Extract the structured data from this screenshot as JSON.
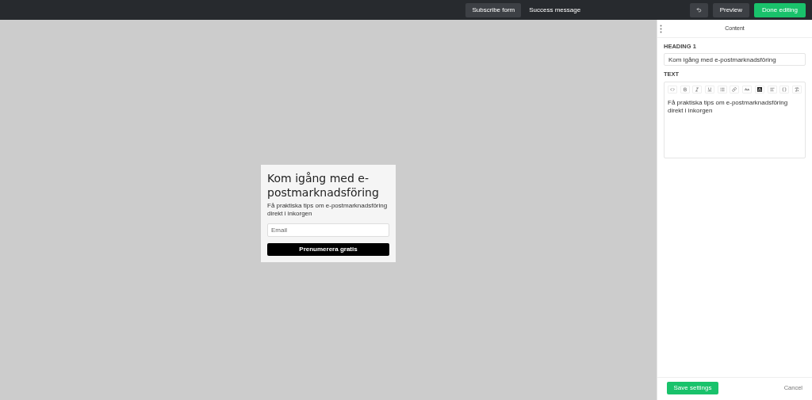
{
  "tabs": [
    {
      "label": "Subscribe form",
      "selected": true
    },
    {
      "label": "Success message",
      "selected": false
    }
  ],
  "actions": {
    "preview": "Preview",
    "done": "Done editing"
  },
  "form": {
    "heading": "Kom igång med e-postmarknadsföring",
    "text": "Få praktiska tips om e-postmarknadsföring direkt i inkorgen",
    "email_placeholder": "Email",
    "button": "Prenumerera gratis"
  },
  "panel": {
    "title": "Content",
    "heading_label": "HEADING 1",
    "heading_value": "Kom igång med e-postmarknadsföring",
    "text_label": "TEXT",
    "text_value": "Få praktiska tips om e-postmarknadsföring direkt i inkorgen",
    "save": "Save settings",
    "cancel": "Cancel"
  }
}
